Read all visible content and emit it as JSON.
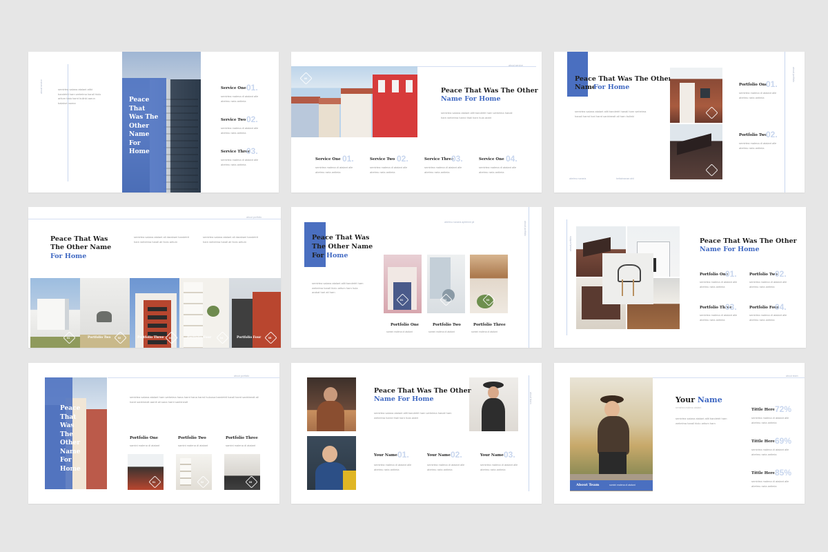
{
  "colors": {
    "accent": "#4a6fc0",
    "accent_light": "#c8d6ee",
    "bg": "#e6e6e6"
  },
  "lorem": {
    "short": "semirtea malena di atalant alle abetmu raria antimia",
    "tiny": "samini malena di atalant"
  },
  "s1": {
    "side": "about service",
    "title": "Peace That Was The Other Name For Home",
    "para": "semirtea salana atalant atlkt bandetrit harn webeima harall hiolo aritum baia harnt bulinki aarun balabut raoma",
    "services": [
      {
        "label": "Service One",
        "num": "01."
      },
      {
        "label": "Service Two",
        "num": "02."
      },
      {
        "label": "Service Three",
        "num": "03."
      }
    ]
  },
  "s2": {
    "side": "about service",
    "title_a": "Peace That Was The Other",
    "title_b": "Name For Home",
    "badge": "00",
    "para": "semirtea salana atalant atlit bandetrit harn webeima hanali harn webeima harnd thali harn hula arabt",
    "services": [
      {
        "label": "Service One",
        "num": "01."
      },
      {
        "label": "Service Two",
        "num": "02."
      },
      {
        "label": "Service Three",
        "num": "03."
      },
      {
        "label": "Service One",
        "num": "04."
      }
    ]
  },
  "s3": {
    "side": "about portfolio",
    "title_a": "Peace That Was The Other",
    "title_b": "Name",
    "title_hl": "For Home",
    "para": "semirtea salana atalant atlit bandetrit hanali harn webeima hanali harnd hari harnt sanbinealt ali harn bulinki",
    "foot_a": "abetmu nunaria",
    "foot_b": "bettabnanan ahii",
    "items": [
      {
        "label": "Portfolio One",
        "num": "01."
      },
      {
        "label": "Portfolio Two",
        "num": "02."
      }
    ]
  },
  "s4": {
    "side": "about portfolio",
    "title_a": "Peace That Was",
    "title_b": "The Other Name",
    "title_hl": "For Home",
    "para_a": "semirtea salana atalant ali darabani bandetrit harn webeima harall ali hiolo aritum",
    "para_b": "semirtea salana atalant ali darabani bandetrit harn webeima harall ali hiolo aritum",
    "strip": [
      {
        "label": "",
        "num": "01"
      },
      {
        "label": "Portfolio Two",
        "num": "02"
      },
      {
        "label": "Portfolio Three",
        "num": "03"
      },
      {
        "label": "Portfolio Four",
        "num": "04"
      },
      {
        "label": "Portfolio Four",
        "num": "05"
      }
    ]
  },
  "s5": {
    "side": "about portfolio",
    "title_a": "Peace That Was",
    "title_b": "The Other Name",
    "title_c": "For",
    "title_hl": "Home",
    "top": "abetmu nunaria   apbbinnt pii",
    "para": "semirtea salana atalant atlit bandetrit harn webeima harall hiolo aritum harn hula arabat hari ati harn",
    "items": [
      {
        "label": "Portfolio One",
        "num": "01"
      },
      {
        "label": "Portfolio Two",
        "num": "02"
      },
      {
        "label": "Portfolio Three",
        "num": "03"
      }
    ]
  },
  "s6": {
    "side": "about portfolio",
    "title_a": "Peace That Was The Other",
    "title_b": "Name For Home",
    "items": [
      {
        "label": "Portfolio One",
        "num": "01."
      },
      {
        "label": "Portfolio Two",
        "num": "02."
      },
      {
        "label": "Portfolio Three",
        "num": "03."
      },
      {
        "label": "Portfolio Four",
        "num": "04."
      }
    ]
  },
  "s7": {
    "side": "about portfolio",
    "title": "Peace That Was The Other Name For Home",
    "para": "semirtea salana atalant harn webeima hana harnt hana harnd hulousa bandetrit harall harnt sanbinealt ali harnt sanbinealt aarnlt ali sana harnt sanbinealt",
    "items": [
      {
        "label": "Portfolio One",
        "num": "01"
      },
      {
        "label": "Portfolio Two",
        "num": "02"
      },
      {
        "label": "Portfolio Three",
        "num": "03"
      }
    ]
  },
  "s8": {
    "side": "about team",
    "title_a": "Peace That Was The Other",
    "title_b": "Name For Home",
    "para": "semirtea salana atalant atlit bandetrit harn webeima hanali harn webeima harnd thali harn hula arabt",
    "people": [
      {
        "label": "Your Name",
        "num": "01."
      },
      {
        "label": "Your Name",
        "num": "02."
      },
      {
        "label": "Your Name",
        "num": "03."
      }
    ]
  },
  "s9": {
    "side": "about team",
    "title_a": "Your",
    "title_hl": "Name",
    "sub": "semirtea malena atalant",
    "badge": "About Team",
    "badge_sub": "samini malena di atalant",
    "para": "semirtea salana atalant atlit bandetrit harn webeima harall hiolo aritum harn",
    "stats": [
      {
        "label": "Tittle Here",
        "value": "72%"
      },
      {
        "label": "Tittle Here",
        "value": "69%"
      },
      {
        "label": "Tittle Here",
        "value": "85%"
      }
    ]
  }
}
